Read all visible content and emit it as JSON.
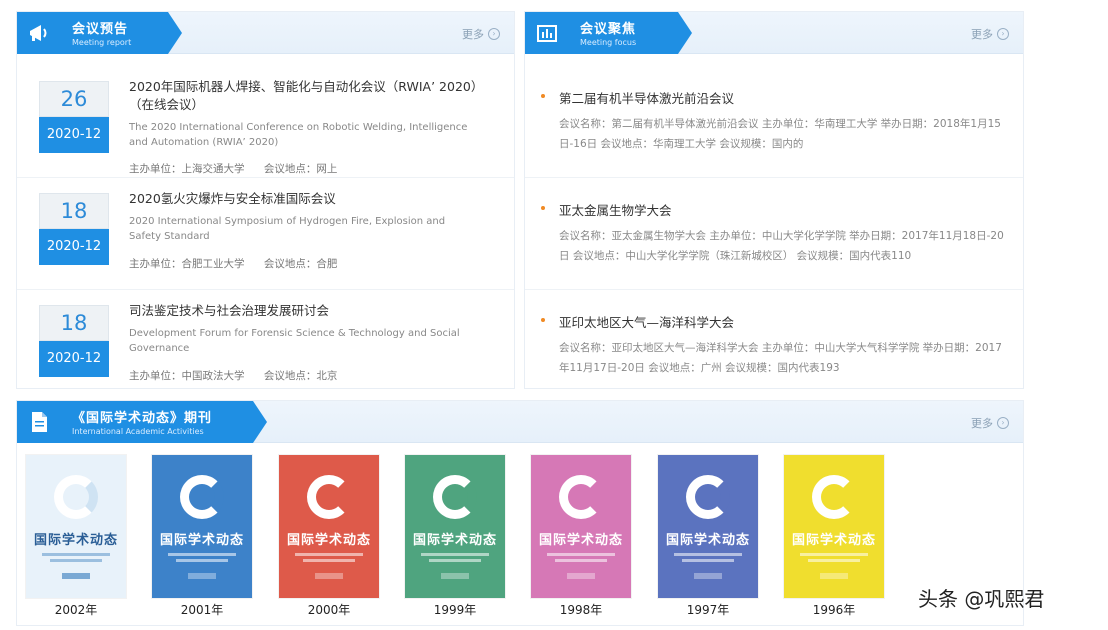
{
  "meeting_report": {
    "title": "会议预告",
    "subtitle": "Meeting report",
    "more": "更多",
    "items": [
      {
        "day": "26",
        "year_month": "2020-12",
        "title": "2020年国际机器人焊接、智能化与自动化会议（RWIA’ 2020）（在线会议）",
        "english": "The 2020 International Conference on Robotic Welding, Intelligence and Automation (RWIA’ 2020)",
        "organizer_label": "主办单位：",
        "organizer": "上海交通大学",
        "venue_label": "会议地点：",
        "venue": "网上"
      },
      {
        "day": "18",
        "year_month": "2020-12",
        "title": "2020氢火灾爆炸与安全标准国际会议",
        "english": "2020 International Symposium of Hydrogen Fire, Explosion and Safety Standard",
        "organizer_label": "主办单位：",
        "organizer": "合肥工业大学",
        "venue_label": "会议地点：",
        "venue": "合肥"
      },
      {
        "day": "18",
        "year_month": "2020-12",
        "title": "司法鉴定技术与社会治理发展研讨会",
        "english": "Development Forum for Forensic Science & Technology and Social Governance",
        "organizer_label": "主办单位：",
        "organizer": "中国政法大学",
        "venue_label": "会议地点：",
        "venue": "北京"
      }
    ]
  },
  "meeting_news": {
    "title": "会议聚焦",
    "subtitle": "Meeting focus",
    "more": "更多",
    "items": [
      {
        "title": "第二届有机半导体激光前沿会议",
        "desc": "会议名称：第二届有机半导体激光前沿会议 主办单位：华南理工大学 举办日期：2018年1月15日-16日 会议地点：华南理工大学 会议规模：国内的"
      },
      {
        "title": "亚太金属生物学大会",
        "desc": "会议名称：亚太金属生物学大会 主办单位：中山大学化学学院 举办日期：2017年11月18日-20日 会议地点：中山大学化学学院（珠江新城校区） 会议规模：国内代表110"
      },
      {
        "title": "亚印太地区大气—海洋科学大会",
        "desc": "会议名称：亚印太地区大气—海洋科学大会 主办单位：中山大学大气科学学院 举办日期：2017年11月17日-20日 会议地点：广州 会议规模：国内代表193"
      }
    ]
  },
  "journal": {
    "title": "《国际学术动态》期刊",
    "subtitle": "International Academic Activities",
    "more": "更多",
    "cover_title": "国际学术动态",
    "issues": [
      {
        "year": "2002年",
        "color": "#e8f2fa"
      },
      {
        "year": "2001年",
        "color": "#3d82c9"
      },
      {
        "year": "2000年",
        "color": "#de5a4a"
      },
      {
        "year": "1999年",
        "color": "#4fa47f"
      },
      {
        "year": "1998年",
        "color": "#d678b6"
      },
      {
        "year": "1997年",
        "color": "#5b73bf"
      },
      {
        "year": "1996年",
        "color": "#f0de2e"
      }
    ]
  },
  "watermark": "头条 @巩熙君"
}
